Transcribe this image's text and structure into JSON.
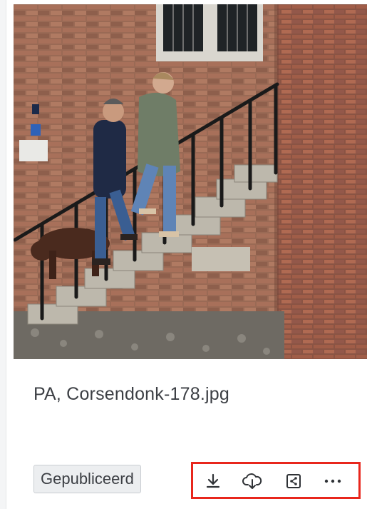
{
  "asset": {
    "filename": "PA, Corsendonk-178.jpg",
    "status": "Gepubliceerd"
  },
  "actions": [
    {
      "icon": "download-icon"
    },
    {
      "icon": "cloud-upload-icon"
    },
    {
      "icon": "share-icon"
    },
    {
      "icon": "more-options-icon"
    }
  ],
  "colors": {
    "highlight": "#e8261c",
    "text": "#3c3f44",
    "badge_bg": "#eceef0"
  }
}
